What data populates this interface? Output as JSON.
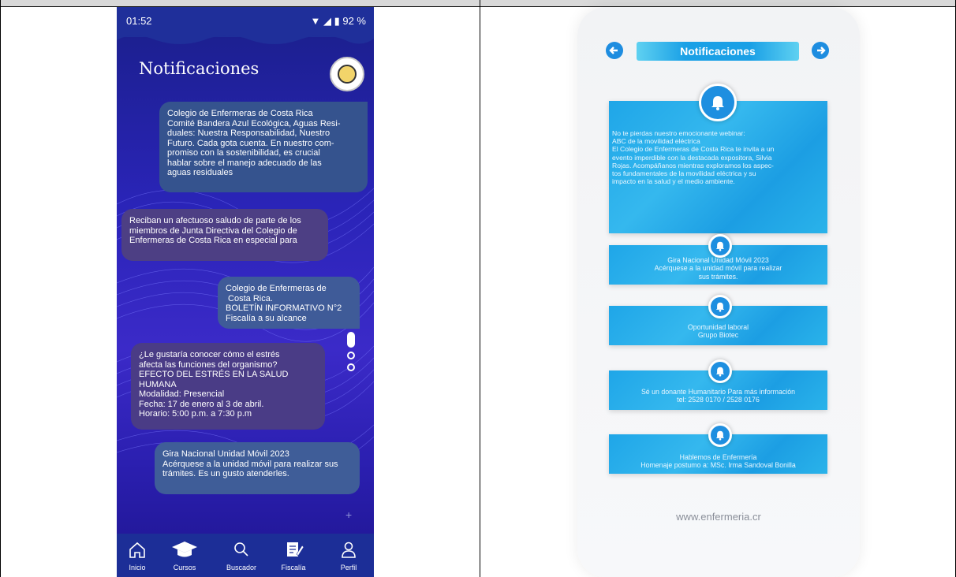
{
  "left": {
    "status": {
      "time": "01:52",
      "battery": "92 %"
    },
    "title": "Notificaciones",
    "bubbles": [
      {
        "lines": [
          "Colegio de Enfermeras de Costa Rica",
          "Comité Bandera Azul Ecológica, Aguas Resi-",
          "duales: Nuestra Responsabilidad, Nuestro",
          "Futuro. Cada gota cuenta.  En nuestro com-",
          "promiso con la sostenibilidad, es crucial",
          "hablar sobre el manejo adecuado de las",
          "aguas residuales"
        ]
      },
      {
        "lines": [
          "Reciban un afectuoso saludo de parte de los",
          "miembros de Junta Directiva del Colegio de",
          "Enfermeras de Costa Rica en especial para"
        ]
      },
      {
        "lines": [
          "Colegio de Enfermeras de",
          " Costa Rica.",
          "BOLETÍN INFORMATIVO N°2",
          "Fiscalía a su alcance"
        ]
      },
      {
        "lines": [
          "¿Le gustaría conocer cómo el estrés",
          "afecta las funciones del organismo?",
          "EFECTO DEL ESTRÉS EN LA SALUD HUMANA",
          "Modalidad: Presencial",
          "Fecha: 17 de enero al 3 de abril.",
          "Horario: 5:00 p.m. a 7:30 p.m"
        ]
      },
      {
        "lines": [
          "Gira Nacional Unidad Móvil 2023",
          "Acérquese a la unidad móvil para realizar sus",
          "trámites. Es un gusto atenderles."
        ]
      }
    ],
    "plus": "+",
    "nav": [
      {
        "label": "Inicio",
        "icon": "home-icon"
      },
      {
        "label": "Cursos",
        "icon": "graduation-cap-icon"
      },
      {
        "label": "Buscador",
        "icon": "search-icon"
      },
      {
        "label": "Fiscalía",
        "icon": "document-pen-icon"
      },
      {
        "label": "Perfil",
        "icon": "user-icon"
      }
    ]
  },
  "right": {
    "title": "Notificaciones",
    "cards": [
      {
        "lines": [
          "No te pierdas nuestro emocionante webinar:",
          "ABC de la movilidad eléctrica",
          "El Colegio de Enfermeras de Costa Rica te invita a un",
          "evento imperdible con la destacada expositora, Silvia",
          "Rojas. Acompáñanos mientras exploramos los aspec-",
          "tos fundamentales de la movilidad eléctrica y su",
          "impacto en la salud y el medio ambiente."
        ]
      },
      {
        "lines": [
          "Gira Nacional Unidad Móvil 2023",
          "Acérquese a la unidad móvil para realizar",
          "sus trámites."
        ]
      },
      {
        "lines": [
          "Oportunidad laboral",
          "Grupo Biotec"
        ]
      },
      {
        "lines": [
          "Sé un donante Humanitario Para más información",
          "tel: 2528 0170 / 2528 0176"
        ]
      },
      {
        "lines": [
          "Hablemos de Enfermería",
          "Homenaje postumo a: MSc. Irma Sandoval Bonilla"
        ]
      }
    ],
    "website": "www.enfermeria.cr"
  },
  "colors": {
    "left_bg": "#2a24b8",
    "accent_blue": "#1e8fe0",
    "card_blue": "#1fa6e8"
  }
}
